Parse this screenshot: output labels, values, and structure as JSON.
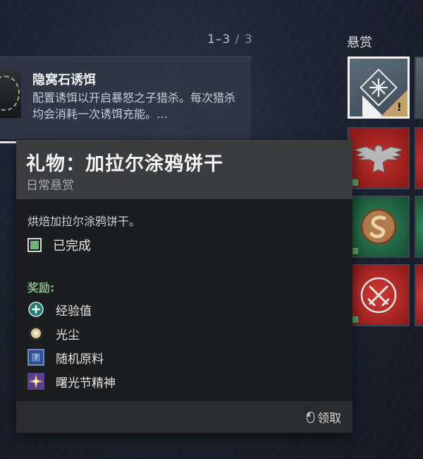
{
  "pagination": {
    "current": "1–3",
    "separator": " / ",
    "total": "3"
  },
  "bounties_header": "悬赏",
  "item": {
    "title": "隐窝石诱饵",
    "description": "配置诱饵以开启暴怒之子猎杀。每次猎杀均会消耗一次诱饵充能。…"
  },
  "tiles": [
    {
      "name": "tile-selected-bounty",
      "alert": "!"
    },
    {
      "name": "tile-eagle-bounty"
    },
    {
      "name": "tile-serpent-bounty"
    },
    {
      "name": "tile-crossed-swords-bounty"
    }
  ],
  "tooltip": {
    "title": "礼物：加拉尔涂鸦饼干",
    "subtitle": "日常悬赏",
    "description": "烘焙加拉尔涂鸦饼干。",
    "objective": {
      "label": "已完成",
      "completed": true
    },
    "rewards_label": "奖励:",
    "rewards": [
      {
        "icon": "xp-plus-icon",
        "label": "经验值"
      },
      {
        "icon": "glimmer-dust-icon",
        "label": "光尘"
      },
      {
        "icon": "random-material-icon",
        "label": "随机原料"
      },
      {
        "icon": "dawning-spirit-icon",
        "label": "曙光节精神"
      }
    ],
    "claim_label": "领取"
  },
  "colors": {
    "objective_fill": "#6cb27a",
    "rewards_label": "#7fb486",
    "tile_alert": "#c2a06a"
  }
}
